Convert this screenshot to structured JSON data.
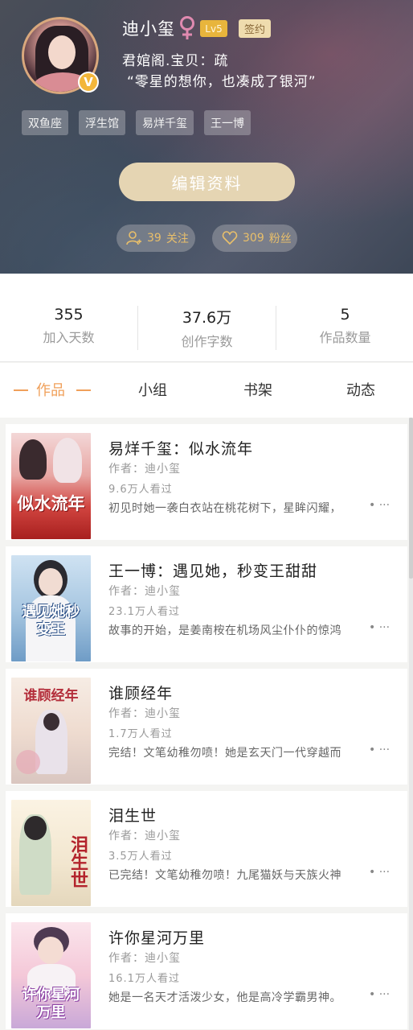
{
  "profile": {
    "username": "迪小玺",
    "level": "Lv5",
    "sign_badge": "签约",
    "bio_line1": "君婠阁.宝贝：疏",
    "bio_line2": "“零星的想你，也凑成了银河”",
    "tags": [
      "双鱼座",
      "浮生馆",
      "易烊千玺",
      "王一博"
    ],
    "edit_button": "编辑资料",
    "follow_count": "39",
    "follow_label": "关注",
    "fans_count": "309",
    "fans_label": "粉丝"
  },
  "stats": [
    {
      "value": "355",
      "label": "加入天数"
    },
    {
      "value": "37.6万",
      "label": "创作字数"
    },
    {
      "value": "5",
      "label": "作品数量"
    }
  ],
  "tabs": [
    {
      "label": "作品",
      "active": true
    },
    {
      "label": "小组",
      "active": false
    },
    {
      "label": "书架",
      "active": false
    },
    {
      "label": "动态",
      "active": false
    }
  ],
  "books": [
    {
      "title": "易烊千玺：似水流年",
      "author": "作者：迪小玺",
      "views": "9.6万人看过",
      "desc": "初见时她一袭白衣站在桃花树下，星眸闪耀，",
      "cover_text": "似水流年",
      "more": "• ···"
    },
    {
      "title": "王一博：遇见她，秒变王甜甜",
      "author": "作者：迪小玺",
      "views": "23.1万人看过",
      "desc": "故事的开始，是姜南桉在机场风尘仆仆的惊鸿",
      "cover_text": "遇见她秒变王",
      "more": "• ···"
    },
    {
      "title": "谁顾经年",
      "author": "作者：迪小玺",
      "views": "1.7万人看过",
      "desc": "完结！文笔幼稚勿喷！她是玄天门一代穿越而",
      "cover_text": "谁顾经年",
      "more": "• ···"
    },
    {
      "title": "泪生世",
      "author": "作者：迪小玺",
      "views": "3.5万人看过",
      "desc": "已完结！文笔幼稚勿喷！九尾猫妖与天族火神",
      "cover_text": "泪生世",
      "more": "• ···"
    },
    {
      "title": "许你星河万里",
      "author": "作者：迪小玺",
      "views": "16.1万人看过",
      "desc": "她是一名天才活泼少女，他是高冷学霸男神。",
      "cover_text": "许你星河万里",
      "more": "• ···"
    }
  ],
  "colors": {
    "accent": "#f0a05a",
    "gold": "#e9bf6a",
    "level_badge": "#e8b53c",
    "edit_button": "#e5d5b3"
  }
}
